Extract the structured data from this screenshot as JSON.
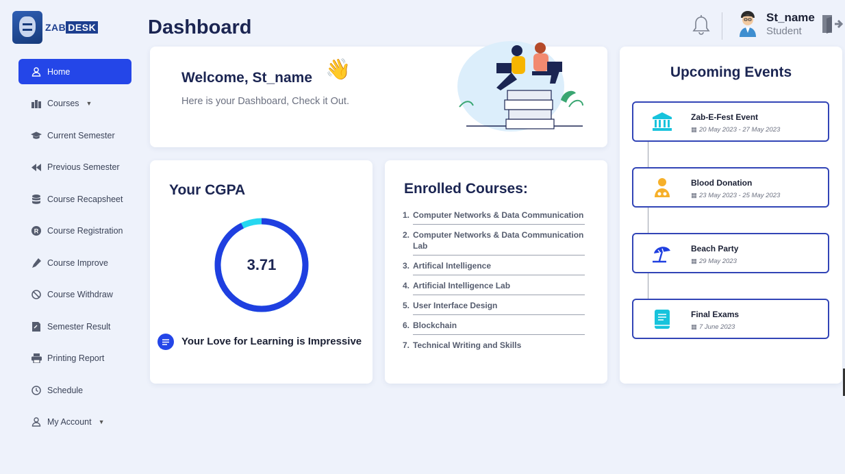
{
  "brand": {
    "logo_prefix": "ZAB",
    "logo_suffix": "DESK"
  },
  "sidebar": {
    "items": [
      {
        "label": "Home",
        "icon": "user-icon",
        "active": true
      },
      {
        "label": "Courses",
        "icon": "books-icon",
        "has_caret": true
      },
      {
        "label": "Current Semester",
        "icon": "graduation-cap-icon"
      },
      {
        "label": "Previous Semester",
        "icon": "backward-icon"
      },
      {
        "label": "Course Recapsheet",
        "icon": "database-icon"
      },
      {
        "label": "Course Registration",
        "icon": "registered-icon"
      },
      {
        "label": "Course Improve",
        "icon": "pen-icon"
      },
      {
        "label": "Course Withdraw",
        "icon": "ban-icon"
      },
      {
        "label": "Semester Result",
        "icon": "result-sheet-icon"
      },
      {
        "label": "Printing Report",
        "icon": "printer-icon"
      },
      {
        "label": "Schedule",
        "icon": "clock-icon"
      },
      {
        "label": "My Account",
        "icon": "user-icon",
        "has_caret": true
      }
    ]
  },
  "header": {
    "title": "Dashboard",
    "user_name": "St_name",
    "user_role": "Student"
  },
  "welcome": {
    "title": "Welcome, St_name",
    "subtitle": "Here is your Dashboard, Check it Out.",
    "emoji": "👋"
  },
  "cgpa": {
    "title": "Your CGPA",
    "value": "3.71",
    "max": 4,
    "message": "Your Love for Learning is Impressive"
  },
  "courses": {
    "title": "Enrolled Courses:",
    "items": [
      {
        "num": "1.",
        "name": "Computer Networks & Data Communication"
      },
      {
        "num": "2.",
        "name": "Computer Networks & Data Communication Lab"
      },
      {
        "num": "3.",
        "name": "Artifical Intelligence"
      },
      {
        "num": "4.",
        "name": "Artificial Intelligence Lab"
      },
      {
        "num": "5.",
        "name": "User Interface Design"
      },
      {
        "num": "6.",
        "name": "Blockchain"
      },
      {
        "num": "7.",
        "name": "Technical Writing and Skills"
      }
    ]
  },
  "events": {
    "title": "Upcoming Events",
    "items": [
      {
        "name": "Zab-E-Fest Event",
        "date": "20 May 2023 - 27 May 2023",
        "icon": "institution-icon"
      },
      {
        "name": "Blood Donation",
        "date": "23 May 2023 - 25 May 2023",
        "icon": "donor-icon"
      },
      {
        "name": "Beach Party",
        "date": "29 May 2023",
        "icon": "beach-umbrella-icon"
      },
      {
        "name": "Final Exams",
        "date": "7 June 2023",
        "icon": "book-icon"
      }
    ]
  },
  "colors": {
    "accent": "#2446e8",
    "title": "#1b2552",
    "ring_main": "#1f3fe0",
    "ring_accent": "#26d7f0",
    "event_border": "#3144b6",
    "event_icon": "#17c3dc"
  }
}
